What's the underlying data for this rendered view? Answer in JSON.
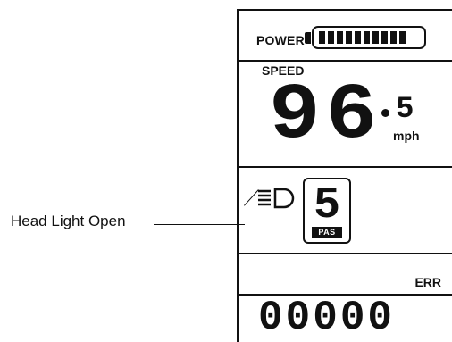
{
  "callout": {
    "text": "Head Light Open"
  },
  "display": {
    "power_label": "POWER",
    "battery_bars": 10,
    "speed_label": "SPEED",
    "speed_integer": "96",
    "speed_decimal": "5",
    "speed_unit": "mph",
    "pas_level": "5",
    "pas_label": "PAS",
    "err_label": "ERR",
    "err_code": "00000"
  },
  "icons": {
    "head_light": "head-light-icon",
    "battery": "battery-icon"
  },
  "colors": {
    "ink": "#111111",
    "background": "#ffffff"
  }
}
